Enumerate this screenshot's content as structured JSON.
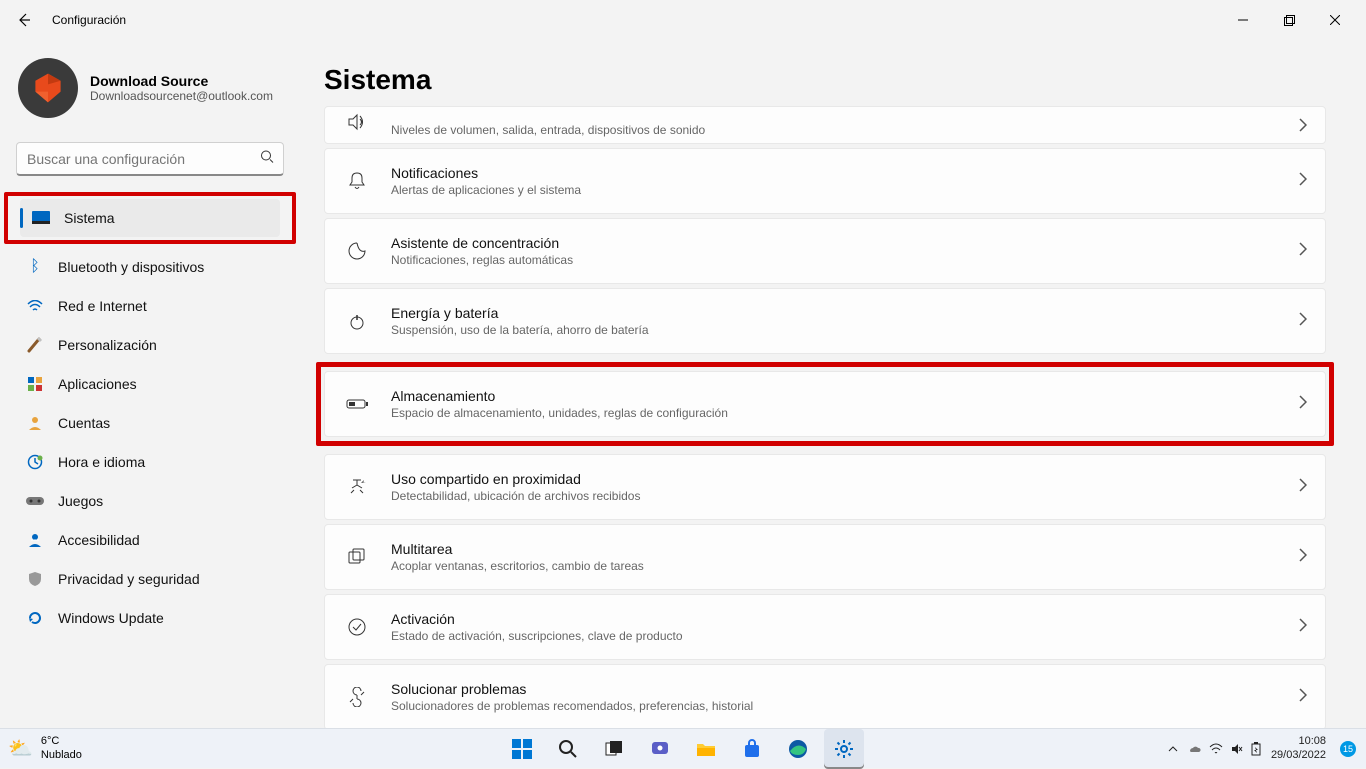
{
  "window": {
    "title": "Configuración"
  },
  "user": {
    "name": "Download Source",
    "email": "Downloadsourcenet@outlook.com"
  },
  "search": {
    "placeholder": "Buscar una configuración"
  },
  "nav": [
    {
      "label": "Sistema",
      "active": true,
      "highlight": true
    },
    {
      "label": "Bluetooth y dispositivos"
    },
    {
      "label": "Red e Internet"
    },
    {
      "label": "Personalización"
    },
    {
      "label": "Aplicaciones"
    },
    {
      "label": "Cuentas"
    },
    {
      "label": "Hora e idioma"
    },
    {
      "label": "Juegos"
    },
    {
      "label": "Accesibilidad"
    },
    {
      "label": "Privacidad y seguridad"
    },
    {
      "label": "Windows Update"
    }
  ],
  "page": {
    "heading": "Sistema"
  },
  "items": [
    {
      "title": "Sonido",
      "desc": "Niveles de volumen, salida, entrada, dispositivos de sonido",
      "cut": true
    },
    {
      "title": "Notificaciones",
      "desc": "Alertas de aplicaciones y el sistema"
    },
    {
      "title": "Asistente de concentración",
      "desc": "Notificaciones, reglas automáticas"
    },
    {
      "title": "Energía y batería",
      "desc": "Suspensión, uso de la batería, ahorro de batería"
    },
    {
      "title": "Almacenamiento",
      "desc": "Espacio de almacenamiento, unidades, reglas de configuración",
      "highlight": true
    },
    {
      "title": "Uso compartido en proximidad",
      "desc": "Detectabilidad, ubicación de archivos recibidos"
    },
    {
      "title": "Multitarea",
      "desc": "Acoplar ventanas, escritorios, cambio de tareas"
    },
    {
      "title": "Activación",
      "desc": "Estado de activación, suscripciones, clave de producto"
    },
    {
      "title": "Solucionar problemas",
      "desc": "Solucionadores de problemas recomendados, preferencias, historial"
    }
  ],
  "taskbar": {
    "weather_temp": "6°C",
    "weather_desc": "Nublado",
    "time": "10:08",
    "date": "29/03/2022",
    "badge": "15"
  }
}
